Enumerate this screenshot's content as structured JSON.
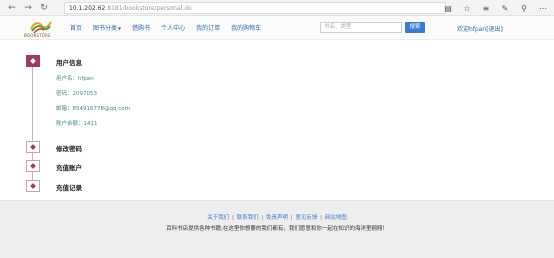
{
  "browser": {
    "url_host": "10.1.202.62",
    "url_path": ":8181/bookstore/personal.do",
    "back_icon": "arrow-left-icon",
    "forward_icon": "arrow-right-icon",
    "reload_icon": "reload-icon"
  },
  "header": {
    "logo_text": "BOOKSTORE",
    "nav": [
      {
        "label": "首页"
      },
      {
        "label": "图书分类"
      },
      {
        "label": "借购书"
      },
      {
        "label": "个人中心"
      },
      {
        "label": "我的订单"
      },
      {
        "label": "我的购物车"
      }
    ],
    "search_placeholder": "书名、类型",
    "search_button": "搜索",
    "welcome": "欢迎hfpan[退出]"
  },
  "sections": [
    {
      "title": "用户信息",
      "active": true,
      "lines": [
        "用户名：hfpan",
        "密码：2097053",
        "邮箱：854916778@qq.com",
        "账户余额：1411"
      ]
    },
    {
      "title": "修改密码",
      "active": false
    },
    {
      "title": "充值账户",
      "active": false
    },
    {
      "title": "充值记录",
      "active": false
    }
  ],
  "footer": {
    "links": [
      "关于我们",
      "联系我们",
      "免责声明",
      "意见反馈",
      "网站地图"
    ],
    "text": "百科书店提供各种书籍,在这里你想要的我们都有，我们愿意和你一起在知识的海洋里翱翔！"
  },
  "colors": {
    "accent": "#a23a5e",
    "link": "#2b6cb3",
    "info_text": "#3d8a8a",
    "button": "#3a7ad6"
  }
}
